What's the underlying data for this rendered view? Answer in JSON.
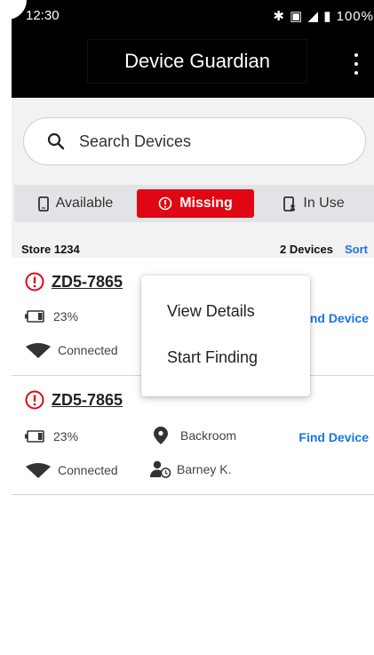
{
  "status_bar": {
    "time": "12:30",
    "battery": "100%"
  },
  "app_bar": {
    "title": "Device Guardian"
  },
  "search": {
    "placeholder": "Search Devices"
  },
  "tabs": [
    {
      "label": "Available",
      "icon": "phone-icon"
    },
    {
      "label": "Missing",
      "icon": "alert-circle-icon",
      "active": true
    },
    {
      "label": "In Use",
      "icon": "phone-user-icon"
    }
  ],
  "list_meta": {
    "store": "Store 1234",
    "count": "2 Devices",
    "sort_label": "Sort"
  },
  "devices": [
    {
      "name": "ZD5-7865",
      "battery": "23%",
      "connection": "Connected",
      "action": "Find Device",
      "action_visible": "ind Device"
    },
    {
      "name": "ZD5-7865",
      "battery": "23%",
      "connection": "Connected",
      "location": "Backroom",
      "user": "Barney K.",
      "action": "Find Device"
    }
  ],
  "context_menu": {
    "items": [
      "View Details",
      "Start Finding"
    ]
  },
  "colors": {
    "accent": "#1a73e8",
    "missing": "#e00613",
    "app_bar": "#000000"
  }
}
